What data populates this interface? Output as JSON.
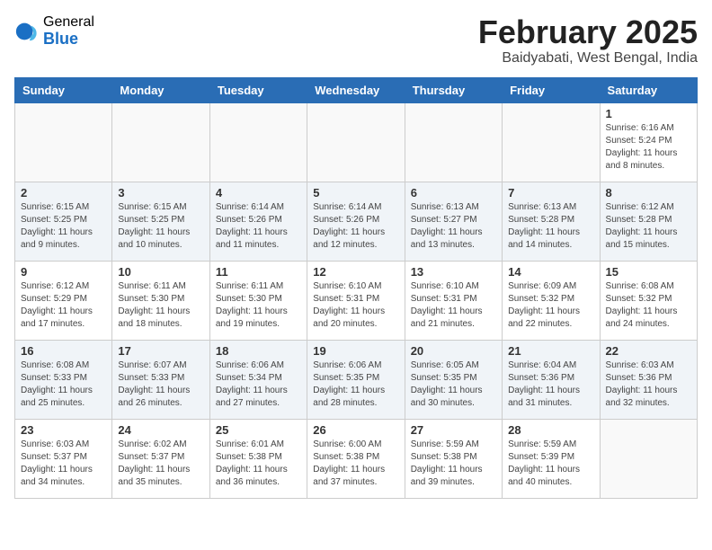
{
  "logo": {
    "general": "General",
    "blue": "Blue"
  },
  "title": "February 2025",
  "subtitle": "Baidyabati, West Bengal, India",
  "days_of_week": [
    "Sunday",
    "Monday",
    "Tuesday",
    "Wednesday",
    "Thursday",
    "Friday",
    "Saturday"
  ],
  "weeks": [
    {
      "days": [
        {
          "num": "",
          "info": ""
        },
        {
          "num": "",
          "info": ""
        },
        {
          "num": "",
          "info": ""
        },
        {
          "num": "",
          "info": ""
        },
        {
          "num": "",
          "info": ""
        },
        {
          "num": "",
          "info": ""
        },
        {
          "num": "1",
          "info": "Sunrise: 6:16 AM\nSunset: 5:24 PM\nDaylight: 11 hours and 8 minutes."
        }
      ]
    },
    {
      "days": [
        {
          "num": "2",
          "info": "Sunrise: 6:15 AM\nSunset: 5:25 PM\nDaylight: 11 hours and 9 minutes."
        },
        {
          "num": "3",
          "info": "Sunrise: 6:15 AM\nSunset: 5:25 PM\nDaylight: 11 hours and 10 minutes."
        },
        {
          "num": "4",
          "info": "Sunrise: 6:14 AM\nSunset: 5:26 PM\nDaylight: 11 hours and 11 minutes."
        },
        {
          "num": "5",
          "info": "Sunrise: 6:14 AM\nSunset: 5:26 PM\nDaylight: 11 hours and 12 minutes."
        },
        {
          "num": "6",
          "info": "Sunrise: 6:13 AM\nSunset: 5:27 PM\nDaylight: 11 hours and 13 minutes."
        },
        {
          "num": "7",
          "info": "Sunrise: 6:13 AM\nSunset: 5:28 PM\nDaylight: 11 hours and 14 minutes."
        },
        {
          "num": "8",
          "info": "Sunrise: 6:12 AM\nSunset: 5:28 PM\nDaylight: 11 hours and 15 minutes."
        }
      ]
    },
    {
      "days": [
        {
          "num": "9",
          "info": "Sunrise: 6:12 AM\nSunset: 5:29 PM\nDaylight: 11 hours and 17 minutes."
        },
        {
          "num": "10",
          "info": "Sunrise: 6:11 AM\nSunset: 5:30 PM\nDaylight: 11 hours and 18 minutes."
        },
        {
          "num": "11",
          "info": "Sunrise: 6:11 AM\nSunset: 5:30 PM\nDaylight: 11 hours and 19 minutes."
        },
        {
          "num": "12",
          "info": "Sunrise: 6:10 AM\nSunset: 5:31 PM\nDaylight: 11 hours and 20 minutes."
        },
        {
          "num": "13",
          "info": "Sunrise: 6:10 AM\nSunset: 5:31 PM\nDaylight: 11 hours and 21 minutes."
        },
        {
          "num": "14",
          "info": "Sunrise: 6:09 AM\nSunset: 5:32 PM\nDaylight: 11 hours and 22 minutes."
        },
        {
          "num": "15",
          "info": "Sunrise: 6:08 AM\nSunset: 5:32 PM\nDaylight: 11 hours and 24 minutes."
        }
      ]
    },
    {
      "days": [
        {
          "num": "16",
          "info": "Sunrise: 6:08 AM\nSunset: 5:33 PM\nDaylight: 11 hours and 25 minutes."
        },
        {
          "num": "17",
          "info": "Sunrise: 6:07 AM\nSunset: 5:33 PM\nDaylight: 11 hours and 26 minutes."
        },
        {
          "num": "18",
          "info": "Sunrise: 6:06 AM\nSunset: 5:34 PM\nDaylight: 11 hours and 27 minutes."
        },
        {
          "num": "19",
          "info": "Sunrise: 6:06 AM\nSunset: 5:35 PM\nDaylight: 11 hours and 28 minutes."
        },
        {
          "num": "20",
          "info": "Sunrise: 6:05 AM\nSunset: 5:35 PM\nDaylight: 11 hours and 30 minutes."
        },
        {
          "num": "21",
          "info": "Sunrise: 6:04 AM\nSunset: 5:36 PM\nDaylight: 11 hours and 31 minutes."
        },
        {
          "num": "22",
          "info": "Sunrise: 6:03 AM\nSunset: 5:36 PM\nDaylight: 11 hours and 32 minutes."
        }
      ]
    },
    {
      "days": [
        {
          "num": "23",
          "info": "Sunrise: 6:03 AM\nSunset: 5:37 PM\nDaylight: 11 hours and 34 minutes."
        },
        {
          "num": "24",
          "info": "Sunrise: 6:02 AM\nSunset: 5:37 PM\nDaylight: 11 hours and 35 minutes."
        },
        {
          "num": "25",
          "info": "Sunrise: 6:01 AM\nSunset: 5:38 PM\nDaylight: 11 hours and 36 minutes."
        },
        {
          "num": "26",
          "info": "Sunrise: 6:00 AM\nSunset: 5:38 PM\nDaylight: 11 hours and 37 minutes."
        },
        {
          "num": "27",
          "info": "Sunrise: 5:59 AM\nSunset: 5:38 PM\nDaylight: 11 hours and 39 minutes."
        },
        {
          "num": "28",
          "info": "Sunrise: 5:59 AM\nSunset: 5:39 PM\nDaylight: 11 hours and 40 minutes."
        },
        {
          "num": "",
          "info": ""
        }
      ]
    }
  ]
}
